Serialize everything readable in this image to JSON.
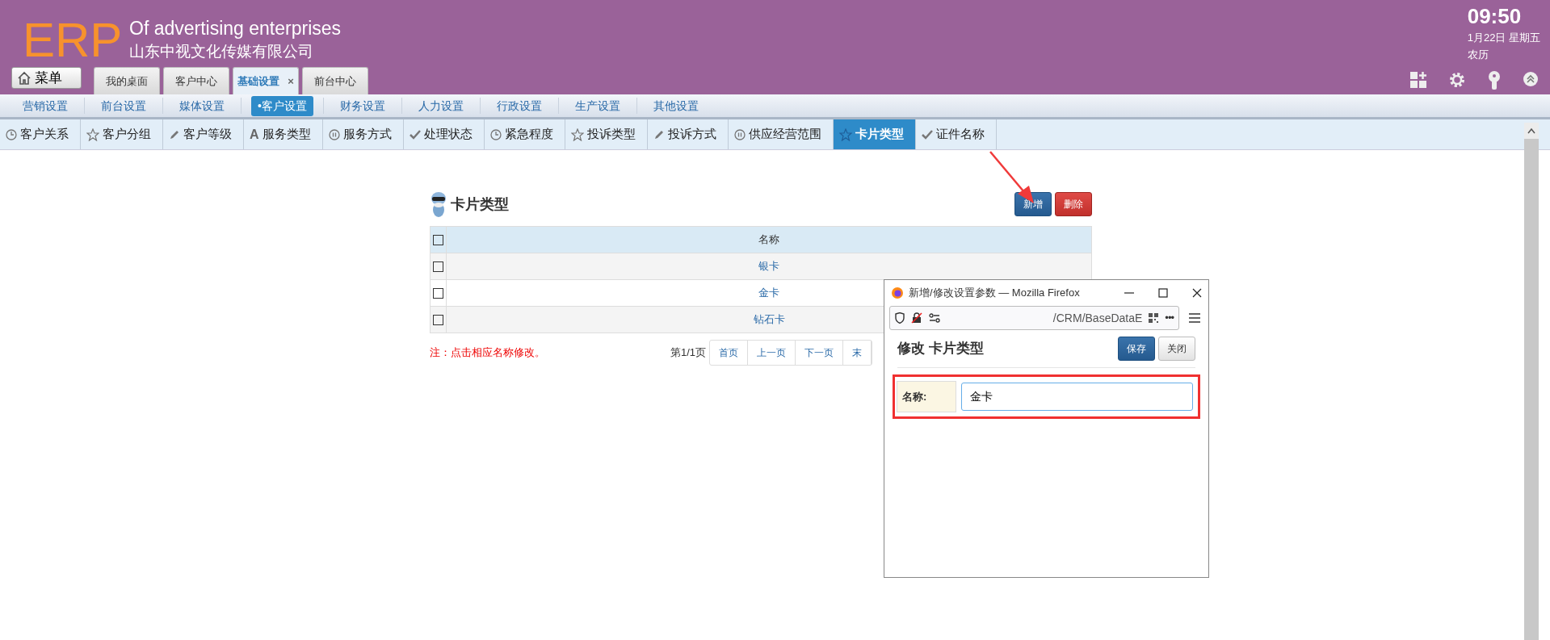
{
  "header": {
    "logo": "ERP",
    "title": "Of advertising enterprises",
    "company": "山东中视文化传媒有限公司",
    "time": "09:50",
    "date": "1月22日 星期五",
    "lunar": "农历",
    "menu_button": "菜单"
  },
  "tabs": [
    {
      "label": "我的桌面",
      "selected": false
    },
    {
      "label": "客户中心",
      "selected": false
    },
    {
      "label": "基础设置",
      "selected": true,
      "close": "×"
    },
    {
      "label": "前台中心",
      "selected": false
    }
  ],
  "menu": [
    {
      "label": "营销设置",
      "selected": false
    },
    {
      "label": "前台设置",
      "selected": false
    },
    {
      "label": "媒体设置",
      "selected": false
    },
    {
      "label": "•客户设置",
      "selected": true
    },
    {
      "label": "财务设置",
      "selected": false
    },
    {
      "label": "人力设置",
      "selected": false
    },
    {
      "label": "行政设置",
      "selected": false
    },
    {
      "label": "生产设置",
      "selected": false
    },
    {
      "label": "其他设置",
      "selected": false
    }
  ],
  "subtabs": [
    {
      "label": "客户关系",
      "kind": "clock",
      "selected": false
    },
    {
      "label": "客户分组",
      "kind": "star",
      "selected": false
    },
    {
      "label": "客户等级",
      "kind": "pencil",
      "selected": false
    },
    {
      "label": "服务类型",
      "kind": "letter",
      "glyph": "A",
      "selected": false
    },
    {
      "label": "服务方式",
      "kind": "pause",
      "selected": false
    },
    {
      "label": "处理状态",
      "kind": "check",
      "selected": false
    },
    {
      "label": "紧急程度",
      "kind": "clock",
      "selected": false
    },
    {
      "label": "投诉类型",
      "kind": "star",
      "selected": false
    },
    {
      "label": "投诉方式",
      "kind": "pencil",
      "selected": false
    },
    {
      "label": "供应经营范围",
      "kind": "pause",
      "selected": false
    },
    {
      "label": "卡片类型",
      "kind": "star",
      "selected": true
    },
    {
      "label": "证件名称",
      "kind": "check",
      "selected": false
    }
  ],
  "panel": {
    "title": "卡片类型",
    "buttons": [
      {
        "label": "新增",
        "kind": "primary"
      },
      {
        "label": "删除",
        "kind": "danger"
      }
    ],
    "table": {
      "all_checked": false,
      "columns": [
        "名称"
      ],
      "rows": [
        {
          "name": "银卡",
          "checked": false
        },
        {
          "name": "金卡",
          "checked": false
        },
        {
          "name": "钻石卡",
          "checked": false
        }
      ]
    },
    "note": "注：点击相应名称修改。",
    "page_info": "第1/1页",
    "pager": [
      "首页",
      "上一页",
      "下一页",
      "末"
    ]
  },
  "popup": {
    "window_title": "新增/修改设置参数 — Mozilla Firefox",
    "url": "/CRM/BaseDataE",
    "more": "•••",
    "heading": "修改 卡片类型",
    "buttons": [
      {
        "label": "保存",
        "kind": "primary"
      },
      {
        "label": "关闭",
        "kind": "default"
      }
    ],
    "form": {
      "label": "名称:",
      "value": "金卡"
    }
  }
}
